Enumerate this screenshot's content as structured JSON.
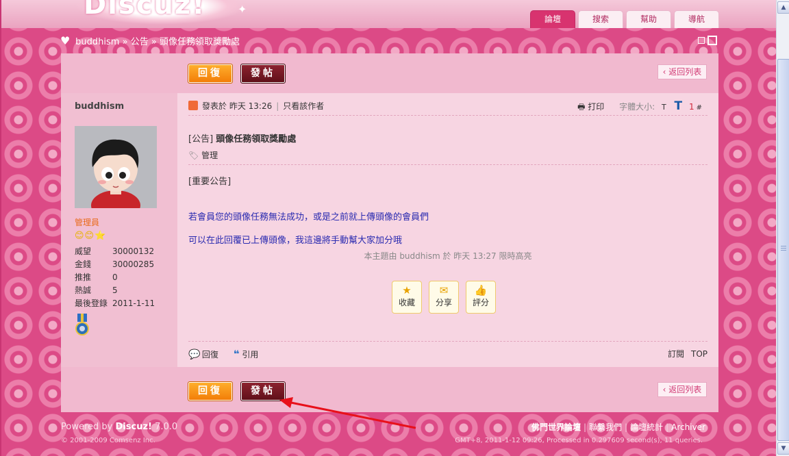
{
  "header": {
    "logo_text": "Discuz!",
    "nav_tabs": [
      "論壇",
      "搜索",
      "幫助",
      "導航"
    ]
  },
  "breadcrumb": {
    "site": "buddhism",
    "sep1": "»",
    "section": "公告",
    "sep2": "»",
    "thread": "頭像任務領取獎勵處"
  },
  "buttons": {
    "reply": "回復",
    "post": "發帖",
    "back_list": "返回列表"
  },
  "author": {
    "name": "buddhism",
    "role": "管理員",
    "rank_icons": "😊😊⭐",
    "stats": [
      {
        "k": "威望",
        "v": "30000132"
      },
      {
        "k": "金錢",
        "v": "30000285"
      },
      {
        "k": "推推",
        "v": "0"
      },
      {
        "k": "熱誠",
        "v": "5"
      },
      {
        "k": "最後登錄",
        "v": "2011-1-11"
      }
    ]
  },
  "post": {
    "posted_at": "發表於 昨天 13:26",
    "only_author": "只看該作者",
    "print": "打印",
    "font_size_label": "字體大小:",
    "font_small": "T",
    "font_large": "T",
    "floor": "1",
    "floor_hash": "#",
    "title_tag": "[公告]",
    "title": "頭像任務領取獎勵處",
    "manage": "管理",
    "body_tag": "[重要公告]",
    "line1": "若會員您的頭像任務無法成功，或是之前就上傳頭像的會員們",
    "line2": "可以在此回覆已上傳頭像，我這邊將手動幫大家加分哦",
    "highlight_note": "本主題由 buddhism 於 昨天 13:27 限時高亮",
    "actions": [
      "收藏",
      "分享",
      "評分"
    ],
    "reply_link": "回復",
    "quote_link": "引用",
    "subscribe": "訂閱",
    "top": "TOP"
  },
  "footer": {
    "powered_prefix": "Powered by",
    "powered_name": "Discuz!",
    "powered_version": "7.0.0",
    "copyright": "© 2001-2009 Comsenz Inc.",
    "links": [
      "佛門世界論壇",
      "聯繫我們",
      "論壇統計",
      "Archiver"
    ],
    "link_sep": "|",
    "stats": "GMT+8, 2011-1-12 09:26, Processed in 0.297609 second(s), 11 queries."
  },
  "colors": {
    "accent": "#d8336f",
    "reply_button": "#f27b06",
    "post_button": "#6e1520",
    "annotation_arrow": "#e8101a"
  },
  "icons": [
    "heart-icon",
    "user-icon",
    "print-icon",
    "tag-icon",
    "star-icon",
    "share-icon",
    "thumb-icon",
    "reply-bubble-icon",
    "quote-icon",
    "medal-icon",
    "arrow-annotation"
  ]
}
